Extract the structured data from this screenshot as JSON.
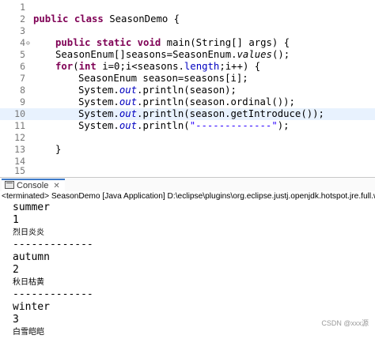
{
  "editor": {
    "line_numbers": [
      "1",
      "2",
      "3",
      "4",
      "5",
      "6",
      "7",
      "8",
      "9",
      "10",
      "11",
      "12",
      "13",
      "14",
      "15"
    ],
    "code": {
      "l2_kw": "public class",
      "l2_rest": " SeasonDemo {",
      "l4_kw": "public static void",
      "l4_rest": " main(String[] args) {",
      "l5_a": "SeasonEnum[]seasons=SeasonEnum.",
      "l5_b": "values",
      "l5_c": "();",
      "l6_kw": "for",
      "l6_a": "(",
      "l6_kw2": "int",
      "l6_b": " i=0;i<seasons.",
      "l6_fld": "length",
      "l6_c": ";i++) {",
      "l7": "SeasonEnum season=seasons[i];",
      "sys": "System.",
      "out": "out",
      "l8_rest": ".println(season);",
      "l9_rest": ".println(season.ordinal());",
      "l10_rest": ".println(season.getIntroduce());",
      "l11_a": ".println(",
      "l11_str": "\"-------------\"",
      "l11_c": ");",
      "l13": "}"
    }
  },
  "console": {
    "tab_label": "Console",
    "close_glyph": "✕",
    "status": "<terminated> SeasonDemo [Java Application] D:\\eclipse\\plugins\\org.eclipse.justj.openjdk.hotspot.jre.full.win32.x86_64_17",
    "output": [
      "summer",
      "1",
      "烈日炎炎",
      "-------------",
      "autumn",
      "2",
      "秋日枯黄",
      "-------------",
      "winter",
      "3",
      "白雪皑皑",
      "-------------"
    ]
  },
  "watermark": "CSDN @xxx源"
}
